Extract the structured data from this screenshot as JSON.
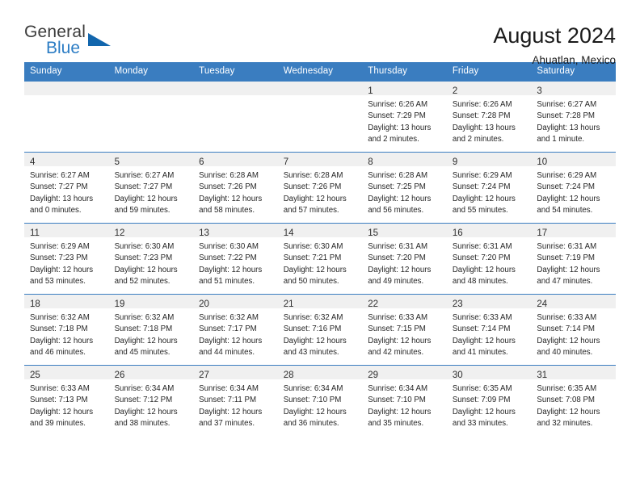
{
  "brand": {
    "line1": "General",
    "line2": "Blue",
    "triangle_color": "#1266ad",
    "blue_color": "#2b7cc4"
  },
  "header": {
    "title": "August 2024",
    "location": "Ahuatlan, Mexico"
  },
  "theme": {
    "header_blue": "#3a7dc0",
    "daynum_band": "#f0f0f0"
  },
  "weekdays": [
    "Sunday",
    "Monday",
    "Tuesday",
    "Wednesday",
    "Thursday",
    "Friday",
    "Saturday"
  ],
  "labels": {
    "sunrise_prefix": "Sunrise:",
    "sunset_prefix": "Sunset:",
    "daylight_prefix": "Daylight:"
  },
  "weeks": [
    [
      {
        "day": "",
        "blank": true
      },
      {
        "day": "",
        "blank": true
      },
      {
        "day": "",
        "blank": true
      },
      {
        "day": "",
        "blank": true
      },
      {
        "day": "1",
        "sunrise": "Sunrise: 6:26 AM",
        "sunset": "Sunset: 7:29 PM",
        "daylight1": "Daylight: 13 hours",
        "daylight2": "and 2 minutes."
      },
      {
        "day": "2",
        "sunrise": "Sunrise: 6:26 AM",
        "sunset": "Sunset: 7:28 PM",
        "daylight1": "Daylight: 13 hours",
        "daylight2": "and 2 minutes."
      },
      {
        "day": "3",
        "sunrise": "Sunrise: 6:27 AM",
        "sunset": "Sunset: 7:28 PM",
        "daylight1": "Daylight: 13 hours",
        "daylight2": "and 1 minute."
      }
    ],
    [
      {
        "day": "4",
        "sunrise": "Sunrise: 6:27 AM",
        "sunset": "Sunset: 7:27 PM",
        "daylight1": "Daylight: 13 hours",
        "daylight2": "and 0 minutes."
      },
      {
        "day": "5",
        "sunrise": "Sunrise: 6:27 AM",
        "sunset": "Sunset: 7:27 PM",
        "daylight1": "Daylight: 12 hours",
        "daylight2": "and 59 minutes."
      },
      {
        "day": "6",
        "sunrise": "Sunrise: 6:28 AM",
        "sunset": "Sunset: 7:26 PM",
        "daylight1": "Daylight: 12 hours",
        "daylight2": "and 58 minutes."
      },
      {
        "day": "7",
        "sunrise": "Sunrise: 6:28 AM",
        "sunset": "Sunset: 7:26 PM",
        "daylight1": "Daylight: 12 hours",
        "daylight2": "and 57 minutes."
      },
      {
        "day": "8",
        "sunrise": "Sunrise: 6:28 AM",
        "sunset": "Sunset: 7:25 PM",
        "daylight1": "Daylight: 12 hours",
        "daylight2": "and 56 minutes."
      },
      {
        "day": "9",
        "sunrise": "Sunrise: 6:29 AM",
        "sunset": "Sunset: 7:24 PM",
        "daylight1": "Daylight: 12 hours",
        "daylight2": "and 55 minutes."
      },
      {
        "day": "10",
        "sunrise": "Sunrise: 6:29 AM",
        "sunset": "Sunset: 7:24 PM",
        "daylight1": "Daylight: 12 hours",
        "daylight2": "and 54 minutes."
      }
    ],
    [
      {
        "day": "11",
        "sunrise": "Sunrise: 6:29 AM",
        "sunset": "Sunset: 7:23 PM",
        "daylight1": "Daylight: 12 hours",
        "daylight2": "and 53 minutes."
      },
      {
        "day": "12",
        "sunrise": "Sunrise: 6:30 AM",
        "sunset": "Sunset: 7:23 PM",
        "daylight1": "Daylight: 12 hours",
        "daylight2": "and 52 minutes."
      },
      {
        "day": "13",
        "sunrise": "Sunrise: 6:30 AM",
        "sunset": "Sunset: 7:22 PM",
        "daylight1": "Daylight: 12 hours",
        "daylight2": "and 51 minutes."
      },
      {
        "day": "14",
        "sunrise": "Sunrise: 6:30 AM",
        "sunset": "Sunset: 7:21 PM",
        "daylight1": "Daylight: 12 hours",
        "daylight2": "and 50 minutes."
      },
      {
        "day": "15",
        "sunrise": "Sunrise: 6:31 AM",
        "sunset": "Sunset: 7:20 PM",
        "daylight1": "Daylight: 12 hours",
        "daylight2": "and 49 minutes."
      },
      {
        "day": "16",
        "sunrise": "Sunrise: 6:31 AM",
        "sunset": "Sunset: 7:20 PM",
        "daylight1": "Daylight: 12 hours",
        "daylight2": "and 48 minutes."
      },
      {
        "day": "17",
        "sunrise": "Sunrise: 6:31 AM",
        "sunset": "Sunset: 7:19 PM",
        "daylight1": "Daylight: 12 hours",
        "daylight2": "and 47 minutes."
      }
    ],
    [
      {
        "day": "18",
        "sunrise": "Sunrise: 6:32 AM",
        "sunset": "Sunset: 7:18 PM",
        "daylight1": "Daylight: 12 hours",
        "daylight2": "and 46 minutes."
      },
      {
        "day": "19",
        "sunrise": "Sunrise: 6:32 AM",
        "sunset": "Sunset: 7:18 PM",
        "daylight1": "Daylight: 12 hours",
        "daylight2": "and 45 minutes."
      },
      {
        "day": "20",
        "sunrise": "Sunrise: 6:32 AM",
        "sunset": "Sunset: 7:17 PM",
        "daylight1": "Daylight: 12 hours",
        "daylight2": "and 44 minutes."
      },
      {
        "day": "21",
        "sunrise": "Sunrise: 6:32 AM",
        "sunset": "Sunset: 7:16 PM",
        "daylight1": "Daylight: 12 hours",
        "daylight2": "and 43 minutes."
      },
      {
        "day": "22",
        "sunrise": "Sunrise: 6:33 AM",
        "sunset": "Sunset: 7:15 PM",
        "daylight1": "Daylight: 12 hours",
        "daylight2": "and 42 minutes."
      },
      {
        "day": "23",
        "sunrise": "Sunrise: 6:33 AM",
        "sunset": "Sunset: 7:14 PM",
        "daylight1": "Daylight: 12 hours",
        "daylight2": "and 41 minutes."
      },
      {
        "day": "24",
        "sunrise": "Sunrise: 6:33 AM",
        "sunset": "Sunset: 7:14 PM",
        "daylight1": "Daylight: 12 hours",
        "daylight2": "and 40 minutes."
      }
    ],
    [
      {
        "day": "25",
        "sunrise": "Sunrise: 6:33 AM",
        "sunset": "Sunset: 7:13 PM",
        "daylight1": "Daylight: 12 hours",
        "daylight2": "and 39 minutes."
      },
      {
        "day": "26",
        "sunrise": "Sunrise: 6:34 AM",
        "sunset": "Sunset: 7:12 PM",
        "daylight1": "Daylight: 12 hours",
        "daylight2": "and 38 minutes."
      },
      {
        "day": "27",
        "sunrise": "Sunrise: 6:34 AM",
        "sunset": "Sunset: 7:11 PM",
        "daylight1": "Daylight: 12 hours",
        "daylight2": "and 37 minutes."
      },
      {
        "day": "28",
        "sunrise": "Sunrise: 6:34 AM",
        "sunset": "Sunset: 7:10 PM",
        "daylight1": "Daylight: 12 hours",
        "daylight2": "and 36 minutes."
      },
      {
        "day": "29",
        "sunrise": "Sunrise: 6:34 AM",
        "sunset": "Sunset: 7:10 PM",
        "daylight1": "Daylight: 12 hours",
        "daylight2": "and 35 minutes."
      },
      {
        "day": "30",
        "sunrise": "Sunrise: 6:35 AM",
        "sunset": "Sunset: 7:09 PM",
        "daylight1": "Daylight: 12 hours",
        "daylight2": "and 33 minutes."
      },
      {
        "day": "31",
        "sunrise": "Sunrise: 6:35 AM",
        "sunset": "Sunset: 7:08 PM",
        "daylight1": "Daylight: 12 hours",
        "daylight2": "and 32 minutes."
      }
    ]
  ]
}
